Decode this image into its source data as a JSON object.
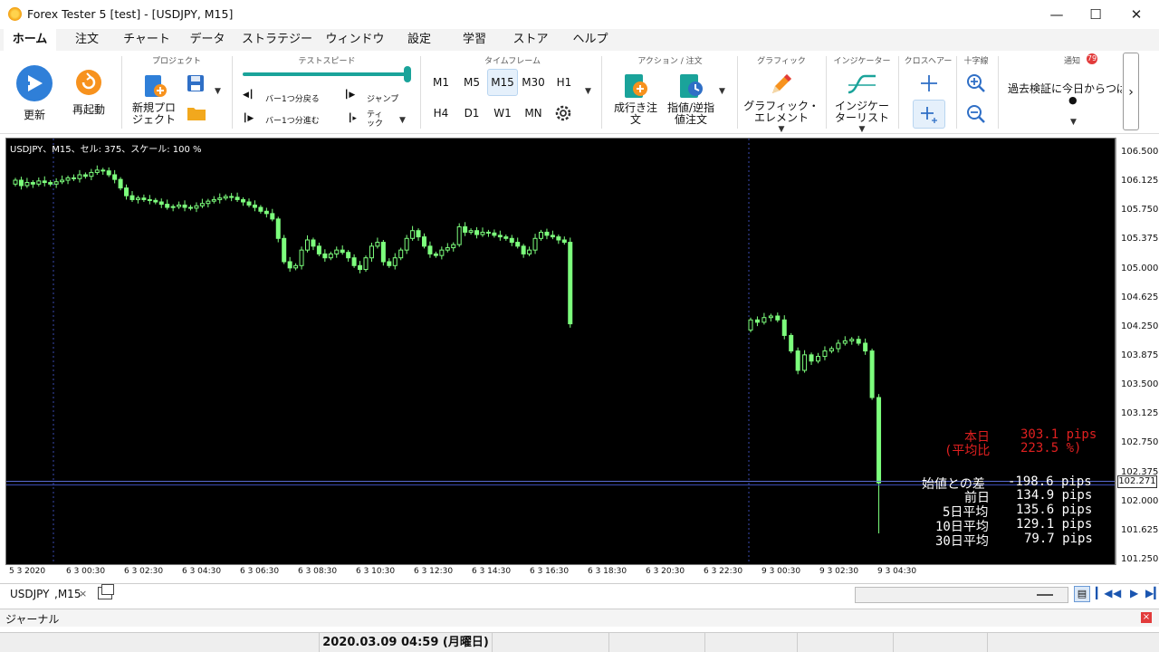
{
  "window": {
    "title": "Forex Tester 5  [test] - [USDJPY, M15]"
  },
  "menu": [
    "ホーム",
    "注文",
    "チャート",
    "データ",
    "ストラテジー",
    "ウィンドウ",
    "設定",
    "学習",
    "ストア",
    "ヘルプ"
  ],
  "ribbon": {
    "update_label": "更新",
    "restart_label": "再起動",
    "project_group": "プロジェクト",
    "new_project_l1": "新規プロ",
    "new_project_l2": "ジェクト",
    "testspeed_group": "テストスピード",
    "back_bar": "バー1つ分戻る",
    "fwd_bar": "バー1つ分進む",
    "jump": "ジャンプ",
    "tick_l1": "ティ",
    "tick_l2": "ック",
    "timeframe_group": "タイムフレーム",
    "timeframes": [
      "M1",
      "M5",
      "M15",
      "M30",
      "H1",
      "H4",
      "D1",
      "W1",
      "MN"
    ],
    "action_group": "アクション / 注文",
    "market_order_l1": "成行き注",
    "market_order_l2": "文",
    "pending_order_l1": "指値/逆指",
    "pending_order_l2": "値注文",
    "graphic_group": "グラフィック",
    "graphic_l1": "グラフィック・",
    "graphic_l2": "エレメント",
    "indicator_group": "インジケーター",
    "indicator_l1": "インジケー",
    "indicator_l2": "ターリスト",
    "crosshair_group": "クロスヘアー",
    "cross_group": "十字線",
    "notify_group": "通知",
    "notify_badge": "79",
    "notify_text": "過去検証に今日からつばさ"
  },
  "chart": {
    "info": "USDJPY、M15、セル: 375、スケール: 100 %",
    "price_tag": "102.271",
    "stats": {
      "today_label": "本日",
      "today_value": "303.1 pips",
      "ratio_label": "(平均比",
      "ratio_value": "223.5 %)",
      "open_diff_label": "始値との差",
      "open_diff_value": "-198.6 pips",
      "prev_label": "前日",
      "prev_value": "134.9 pips",
      "avg5_label": "5日平均",
      "avg5_value": "135.6 pips",
      "avg10_label": "10日平均",
      "avg10_value": "129.1 pips",
      "avg30_label": "30日平均",
      "avg30_value": "79.7 pips"
    }
  },
  "chart_data": {
    "type": "candlestick",
    "symbol": "USDJPY",
    "timeframe": "M15",
    "ylim": [
      101.25,
      106.6
    ],
    "y_ticks": [
      "106.500",
      "106.125",
      "105.750",
      "105.375",
      "105.000",
      "104.625",
      "104.250",
      "103.875",
      "103.500",
      "103.125",
      "102.750",
      "102.375",
      "102.000",
      "101.625",
      "101.250"
    ],
    "x_ticks": [
      "5 3 2020",
      "6 3 00:30",
      "6 3 02:30",
      "6 3 04:30",
      "6 3 06:30",
      "6 3 08:30",
      "6 3 10:30",
      "6 3 12:30",
      "6 3 14:30",
      "6 3 16:30",
      "6 3 18:30",
      "6 3 20:30",
      "6 3 22:30",
      "9 3 00:30",
      "9 3 02:30",
      "9 3 04:30"
    ],
    "current_price": 102.271,
    "closes": [
      106.15,
      106.08,
      106.12,
      106.1,
      106.14,
      106.12,
      106.1,
      106.13,
      106.15,
      106.18,
      106.17,
      106.22,
      106.2,
      106.25,
      106.28,
      106.27,
      106.22,
      106.16,
      106.05,
      105.95,
      105.9,
      105.92,
      105.9,
      105.89,
      105.87,
      105.84,
      105.8,
      105.81,
      105.83,
      105.8,
      105.79,
      105.82,
      105.85,
      105.88,
      105.9,
      105.92,
      105.94,
      105.93,
      105.9,
      105.87,
      105.83,
      105.8,
      105.75,
      105.72,
      105.65,
      105.4,
      105.1,
      105.02,
      105.05,
      105.25,
      105.38,
      105.3,
      105.2,
      105.15,
      105.2,
      105.25,
      105.22,
      105.15,
      105.05,
      105.0,
      105.15,
      105.3,
      105.35,
      105.1,
      105.05,
      105.15,
      105.25,
      105.4,
      105.5,
      105.42,
      105.3,
      105.2,
      105.18,
      105.25,
      105.28,
      105.32,
      105.55,
      105.48,
      105.5,
      105.45,
      105.48,
      105.47,
      105.44,
      105.42,
      105.4,
      105.35,
      105.3,
      105.2,
      105.25,
      105.4,
      105.48,
      105.44,
      105.42,
      105.38,
      105.35,
      104.3,
      104.35,
      104.32,
      104.38,
      104.4,
      104.35,
      104.15,
      103.95,
      103.7,
      103.9,
      103.82,
      103.88,
      103.95,
      103.98,
      104.05,
      104.08,
      104.1,
      104.05,
      103.95,
      103.35,
      102.25
    ]
  }
}
